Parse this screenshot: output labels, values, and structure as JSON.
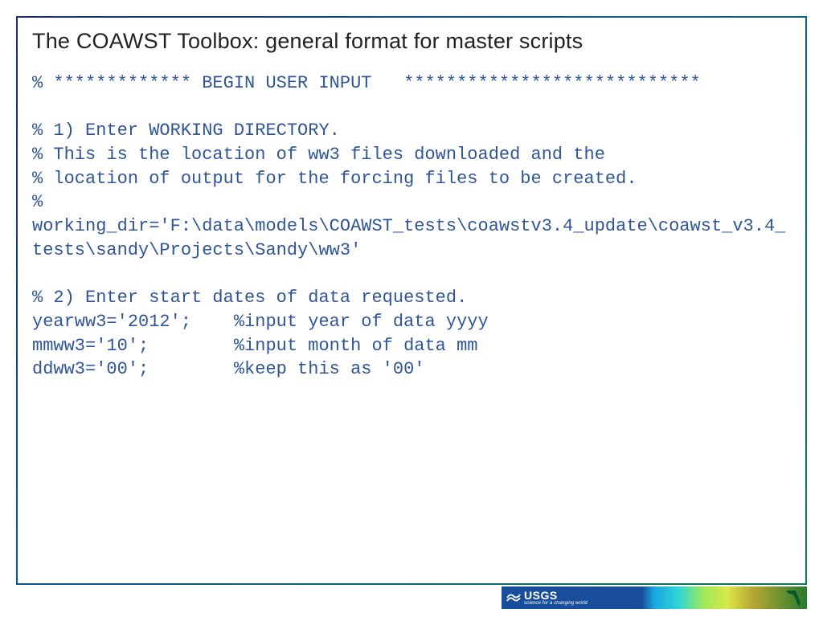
{
  "title": "The COAWST Toolbox: general format for master scripts",
  "code": "% ************* BEGIN USER INPUT   ****************************\n\n% 1) Enter WORKING DIRECTORY.\n% This is the location of ww3 files downloaded and the\n% location of output for the forcing files to be created.\n%\nworking_dir='F:\\data\\models\\COAWST_tests\\coawstv3.4_update\\coawst_v3.4_tests\\sandy\\Projects\\Sandy\\ww3'\n\n% 2) Enter start dates of data requested.\nyearww3='2012';    %input year of data yyyy\nmmww3='10';        %input month of data mm\nddww3='00';        %keep this as '00'",
  "footer": {
    "logo_main": "USGS",
    "logo_tagline": "science for a changing world"
  }
}
